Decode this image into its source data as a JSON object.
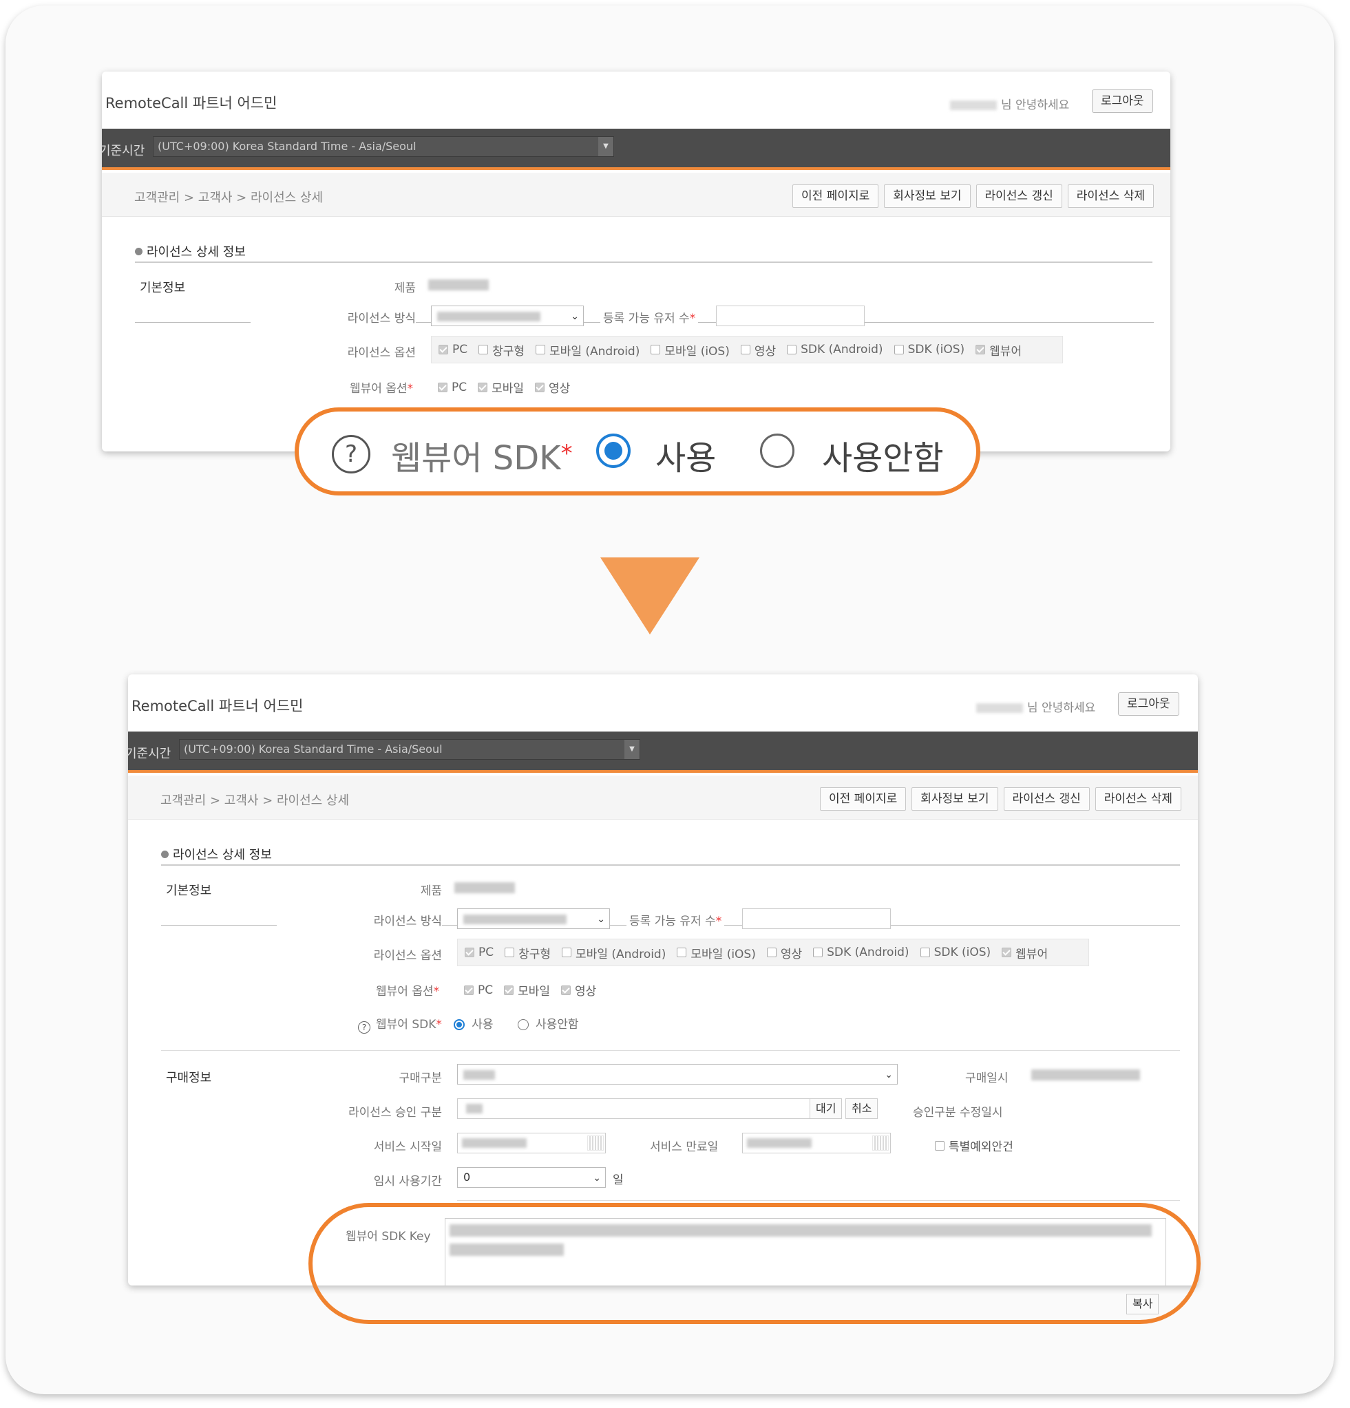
{
  "app_title": "RemoteCall 파트너 어드민",
  "greeting": "님 안녕하세요",
  "logout_label": "로그아웃",
  "timezone": {
    "label": "기준시간",
    "selected": "(UTC+09:00) Korea Standard Time - Asia/Seoul"
  },
  "breadcrumb": "고객관리 > 고객사 > 라이선스 상세",
  "actions": [
    "이전 페이지로",
    "회사정보 보기",
    "라이선스 갱신",
    "라이선스 삭제"
  ],
  "section_title": "라이선스 상세 정보",
  "basic": {
    "group_label": "기본정보",
    "product_label": "제품",
    "license_method_label": "라이선스 방식",
    "users_label": "등록 가능 유저 수",
    "options_label": "라이선스 옵션",
    "options": [
      {
        "label": "PC",
        "checked": true
      },
      {
        "label": "창구형",
        "checked": false
      },
      {
        "label": "모바일 (Android)",
        "checked": false
      },
      {
        "label": "모바일 (iOS)",
        "checked": false
      },
      {
        "label": "영상",
        "checked": false
      },
      {
        "label": "SDK (Android)",
        "checked": false
      },
      {
        "label": "SDK (iOS)",
        "checked": false
      },
      {
        "label": "웹뷰어",
        "checked": true
      }
    ],
    "webviewer_options_label": "웹뷰어 옵션",
    "webviewer_options": [
      {
        "label": "PC",
        "checked": true
      },
      {
        "label": "모바일",
        "checked": true
      },
      {
        "label": "영상",
        "checked": true
      }
    ],
    "required_mark": "*"
  },
  "webviewer_sdk": {
    "label": "웹뷰어 SDK",
    "use_label": "사용",
    "nouse_label": "사용안함",
    "selected": "사용",
    "help_icon": "?"
  },
  "purchase": {
    "group_label": "구매정보",
    "type_label": "구매구분",
    "date_label": "구매일시",
    "approval_label": "라이선스 승인 구분",
    "wait_btn": "대기",
    "cancel_btn": "취소",
    "approval_modified_label": "승인구분 수정일시",
    "start_label": "서비스 시작일",
    "end_label": "서비스 만료일",
    "exception_label": "특별예외안건",
    "temp_label": "임시 사용기간",
    "temp_value": "0",
    "temp_unit": "일"
  },
  "sdk_key": {
    "label": "웹뷰어 SDK Key",
    "copy_btn": "복사"
  },
  "colors": {
    "accent": "#f0822e",
    "arrow": "#f39c55",
    "radio": "#1e7fd6",
    "bar": "#4c4c4c"
  }
}
